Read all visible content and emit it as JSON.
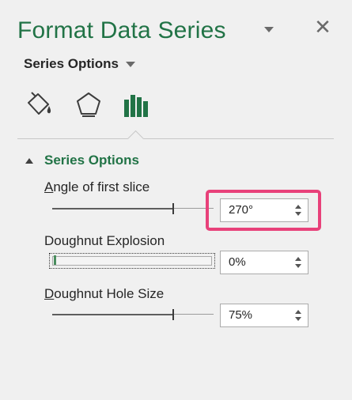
{
  "panel": {
    "title": "Format Data Series",
    "close_glyph": "✕"
  },
  "series_options_menu": {
    "label": "Series Options"
  },
  "tabs": [
    {
      "icon": "paint-bucket-icon"
    },
    {
      "icon": "pentagon-icon"
    },
    {
      "icon": "bar-chart-icon",
      "selected": true
    }
  ],
  "section": {
    "header": "Series Options"
  },
  "fields": {
    "angle_first_slice": {
      "label_accel": "A",
      "label_rest": "ngle of first slice",
      "value": "270°",
      "level": 0.75
    },
    "doughnut_explosion": {
      "label": "Doughnut Explosion",
      "value": "0%",
      "level": 0.0
    },
    "doughnut_hole_size": {
      "label_accel": "D",
      "label_rest": "oughnut Hole Size",
      "value": "75%",
      "level": 0.75
    }
  },
  "colors": {
    "accent": "#217346",
    "highlight": "#e8417a",
    "pane_bg": "#f0f0f0"
  }
}
